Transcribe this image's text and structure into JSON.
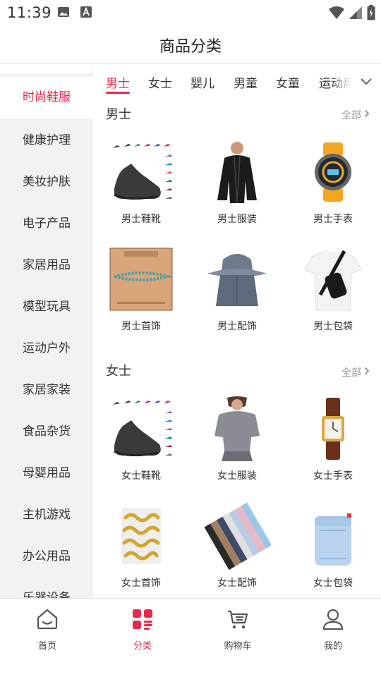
{
  "status_bar": {
    "time": "11:39",
    "left_icons": [
      "image-icon",
      "font-icon"
    ],
    "right_icons": [
      "wifi-icon",
      "signal-icon",
      "battery-icon"
    ]
  },
  "header": {
    "title": "商品分类"
  },
  "sidebar": {
    "items": [
      {
        "label": "时尚鞋服",
        "active": true
      },
      {
        "label": "健康护理"
      },
      {
        "label": "美妆护肤"
      },
      {
        "label": "电子产品"
      },
      {
        "label": "家居用品"
      },
      {
        "label": "模型玩具"
      },
      {
        "label": "运动户外"
      },
      {
        "label": "家居家装"
      },
      {
        "label": "食品杂货"
      },
      {
        "label": "母婴用品"
      },
      {
        "label": "主机游戏"
      },
      {
        "label": "办公用品"
      },
      {
        "label": "乐器设备"
      }
    ]
  },
  "tabs": {
    "items": [
      {
        "label": "男士",
        "active": true
      },
      {
        "label": "女士"
      },
      {
        "label": "婴儿"
      },
      {
        "label": "男童"
      },
      {
        "label": "女童"
      },
      {
        "label": "运动用"
      }
    ],
    "more_icon": "chevron-down-icon"
  },
  "sections": [
    {
      "title": "男士",
      "see_all": "全部",
      "products": [
        {
          "label": "男士鞋靴",
          "icon": "shoe-icon"
        },
        {
          "label": "男士服装",
          "icon": "jacket-icon"
        },
        {
          "label": "男士手表",
          "icon": "watch-icon"
        },
        {
          "label": "男士首饰",
          "icon": "bracelet-icon"
        },
        {
          "label": "男士配饰",
          "icon": "hat-icon"
        },
        {
          "label": "男士包袋",
          "icon": "sling-bag-icon"
        }
      ]
    },
    {
      "title": "女士",
      "see_all": "全部",
      "products": [
        {
          "label": "女士鞋靴",
          "icon": "shoe-icon"
        },
        {
          "label": "女士服装",
          "icon": "top-icon"
        },
        {
          "label": "女士手表",
          "icon": "watch-icon"
        },
        {
          "label": "女士首饰",
          "icon": "hair-clip-icon"
        },
        {
          "label": "女士配饰",
          "icon": "sleeves-icon"
        },
        {
          "label": "女士包袋",
          "icon": "bag-icon"
        }
      ]
    }
  ],
  "bottom_nav": {
    "items": [
      {
        "label": "首页",
        "icon": "home-icon"
      },
      {
        "label": "分类",
        "icon": "category-icon",
        "active": true
      },
      {
        "label": "购物车",
        "icon": "cart-icon"
      },
      {
        "label": "我的",
        "icon": "profile-icon"
      }
    ]
  },
  "colors": {
    "accent": "#e8294a",
    "sidebar_bg": "#f2f2f2",
    "text": "#333333",
    "muted": "#999999"
  }
}
